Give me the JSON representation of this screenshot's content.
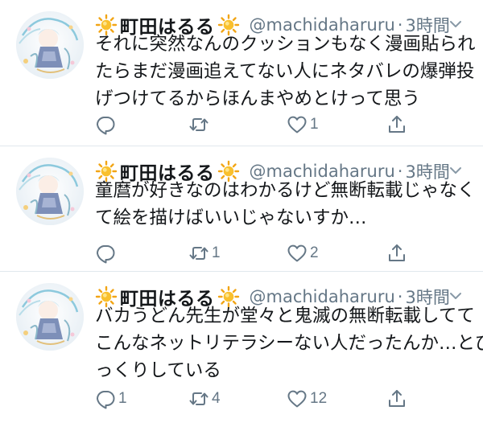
{
  "tweets": [
    {
      "display_name": "町田はるる",
      "handle": "@machidaharuru",
      "separator": "·",
      "time": "3時間",
      "lines": [
        "それに突然なんのクッションもなく漫画貼られ",
        "たらまだ漫画追えてない人にネタバレの爆弾投",
        "げつけてるからほんまやめとけって思う"
      ],
      "reply_count": "",
      "retweet_count": "",
      "like_count": "1"
    },
    {
      "display_name": "町田はるる",
      "handle": "@machidaharuru",
      "separator": "·",
      "time": "3時間",
      "lines": [
        "童麿が好きなのはわかるけど無断転載じゃなく",
        "て絵を描けばいいじゃないすか…"
      ],
      "reply_count": "",
      "retweet_count": "1",
      "like_count": "2"
    },
    {
      "display_name": "町田はるる",
      "handle": "@machidaharuru",
      "separator": "·",
      "time": "3時間",
      "lines": [
        "バカうどん先生が堂々と鬼滅の無断転載してて",
        "こんなネットリテラシーない人だったんか…とび",
        "っくりしている"
      ],
      "reply_count": "1",
      "retweet_count": "4",
      "like_count": "12"
    }
  ],
  "icons": {
    "name_decoration": "sun-icon",
    "reply": "reply-icon",
    "retweet": "retweet-icon",
    "like": "heart-icon",
    "share": "share-icon",
    "more": "chevron-down-icon"
  },
  "colors": {
    "text": "#14171a",
    "secondary": "#657786",
    "divider": "#e1e8ed",
    "sun": "#f7b733"
  }
}
